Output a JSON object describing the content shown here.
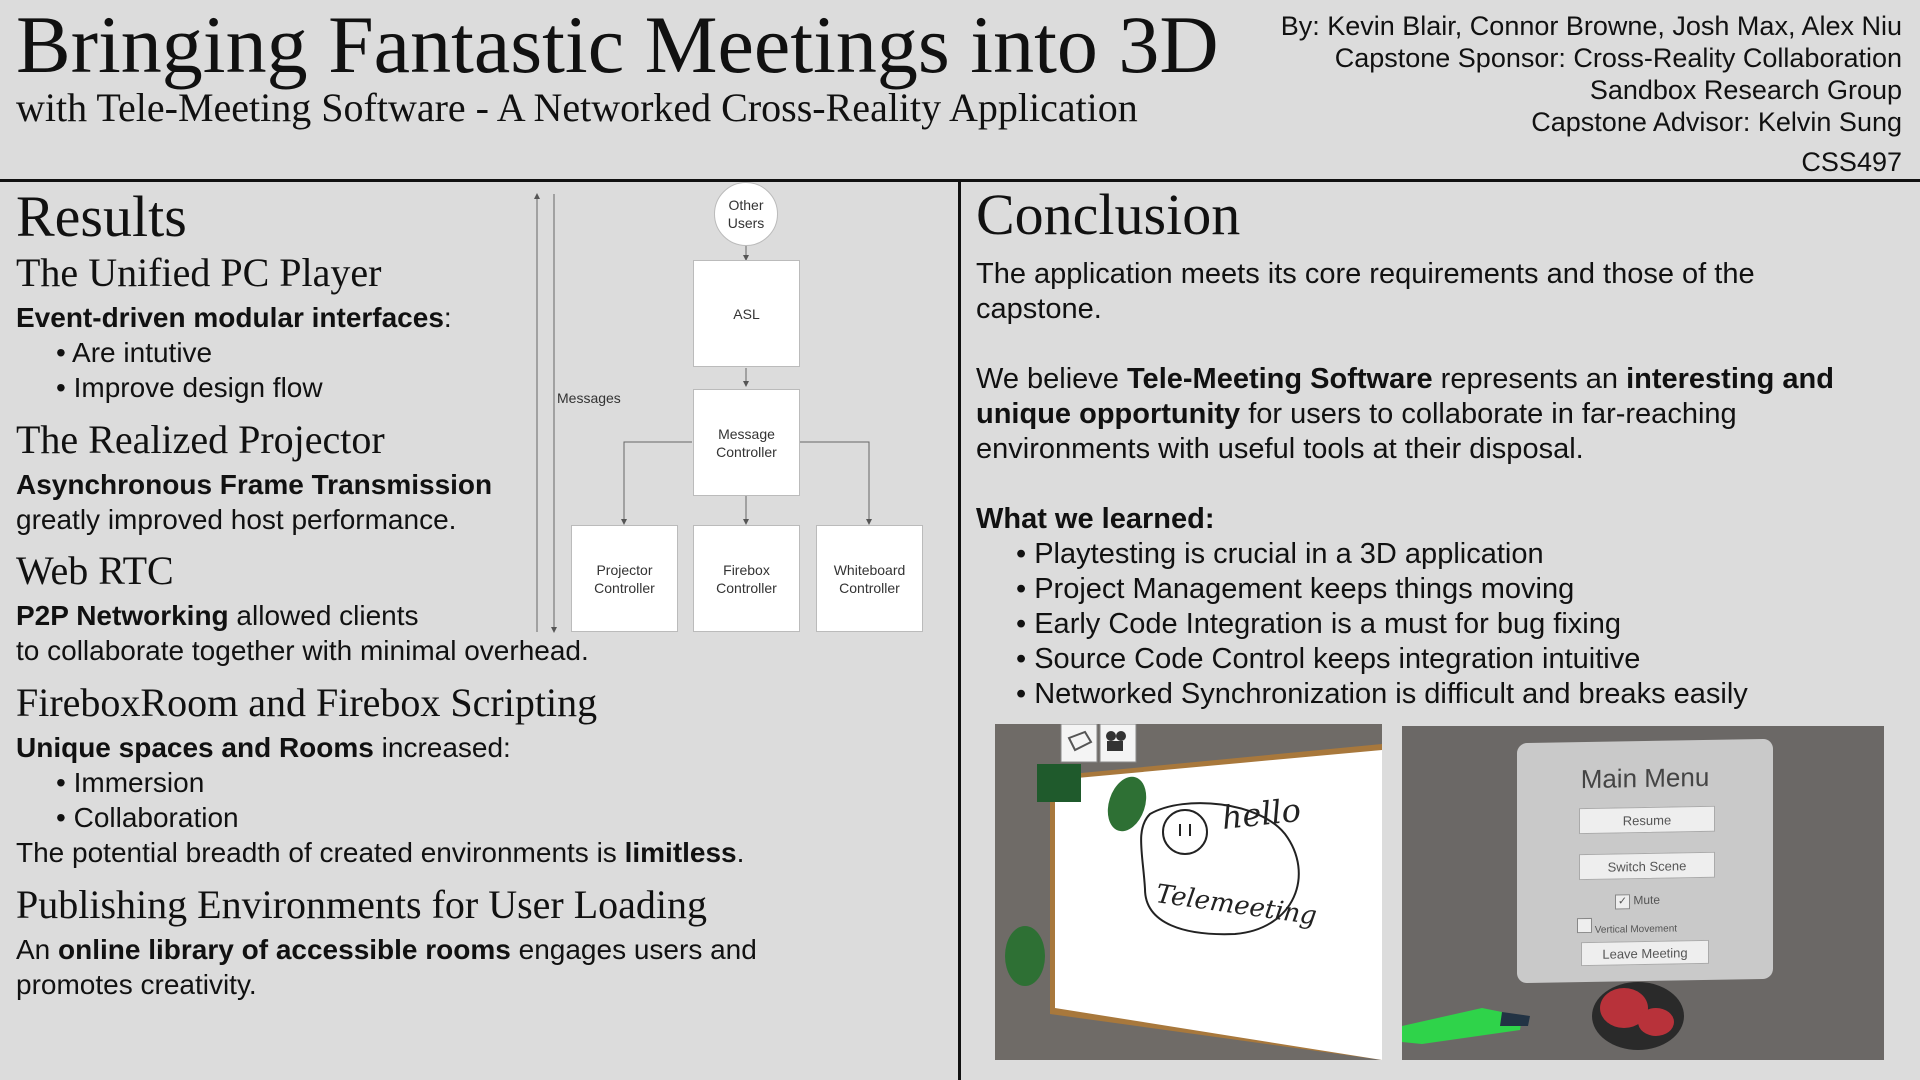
{
  "header": {
    "title": "Bringing Fantastic Meetings into 3D",
    "subtitle": "with Tele-Meeting Software - A Networked Cross-Reality Application",
    "credits": [
      "By: Kevin Blair, Connor Browne, Josh Max, Alex Niu",
      "Capstone Sponsor: Cross-Reality Collaboration",
      "Sandbox Research Group",
      "Capstone Advisor: Kelvin Sung"
    ],
    "course": "CSS497"
  },
  "results": {
    "heading": "Results",
    "pc_player": {
      "title": "The Unified PC Player",
      "bold": "Event-driven modular interfaces",
      "after_bold": ":",
      "bullets": [
        "Are intutive",
        "Improve design flow"
      ]
    },
    "projector": {
      "title": "The Realized Projector",
      "bold": "Asynchronous Frame Transmission",
      "line2": "greatly improved host performance."
    },
    "webrtc": {
      "title": "Web RTC",
      "bold": "P2P Networking",
      "after_bold": " allowed clients",
      "line2": "to collaborate together with minimal overhead."
    },
    "firebox": {
      "title": "FireboxRoom and Firebox Scripting",
      "bold": "Unique spaces and Rooms",
      "after_bold": " increased:",
      "bullets": [
        "Immersion",
        "Collaboration"
      ],
      "closing_pre": "The potential breadth of created environments is ",
      "closing_bold": "limitless",
      "closing_post": "."
    },
    "publishing": {
      "title": "Publishing Environments for User Loading",
      "pre": "An ",
      "bold": "online library of accessible rooms",
      "post": " engages users and",
      "line2": "promotes creativity."
    }
  },
  "diagram": {
    "messages_label": "Messages",
    "other_users": [
      "Other",
      "Users"
    ],
    "asl": "ASL",
    "message_controller": [
      "Message",
      "Controller"
    ],
    "projector_controller": [
      "Projector",
      "Controller"
    ],
    "firebox_controller": [
      "Firebox",
      "Controller"
    ],
    "whiteboard_controller": [
      "Whiteboard",
      "Controller"
    ]
  },
  "conclusion": {
    "heading": "Conclusion",
    "p1": "The application meets its core requirements and those of the capstone.",
    "p2_pre": "We believe ",
    "p2_bold1": "Tele-Meeting Software",
    "p2_mid": " represents an ",
    "p2_bold2": "interesting and unique opportunity",
    "p2_post": " for users to collaborate in far-reaching environments with useful tools at their disposal.",
    "learned_heading": "What we learned:",
    "learned": [
      "Playtesting is crucial in a 3D application",
      "Project Management keeps things moving",
      "Early Code Integration is a must for bug fixing",
      "Source Code Control keeps integration intuitive",
      "Networked Synchronization is difficult and breaks easily"
    ]
  },
  "screenshots": {
    "whiteboard": {
      "hello": "hello",
      "telemeeting": "Telemeeting"
    },
    "menu": {
      "title": "Main Menu",
      "resume": "Resume",
      "switch_scene": "Switch Scene",
      "mute": "Mute",
      "vertical_movement": "Vertical Movement",
      "leave_meeting": "Leave Meeting"
    }
  }
}
